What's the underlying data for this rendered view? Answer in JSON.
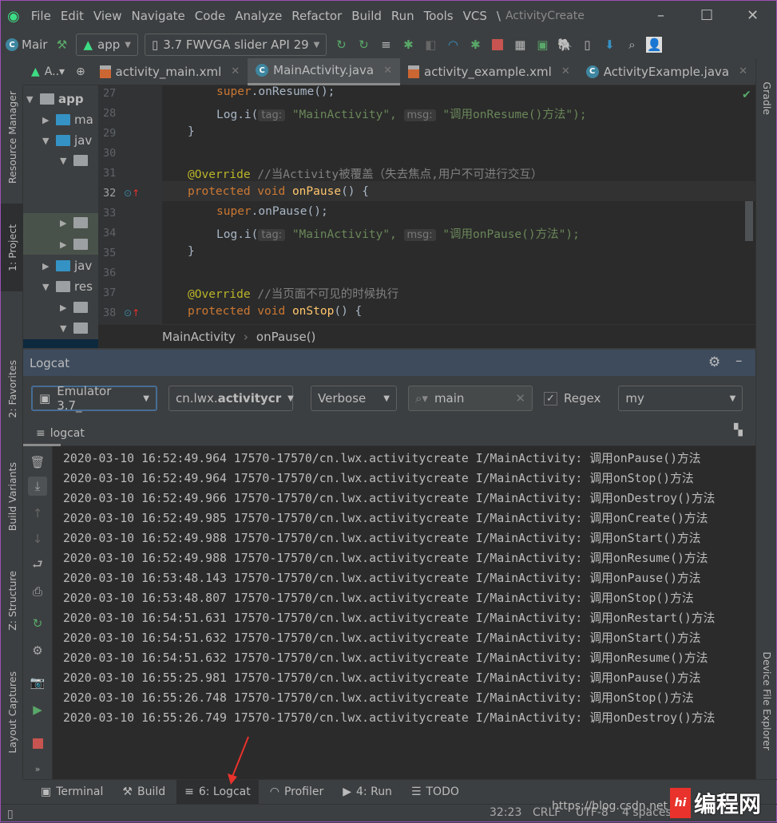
{
  "menu": {
    "items": [
      "File",
      "Edit",
      "View",
      "Navigate",
      "Code",
      "Analyze",
      "Refactor",
      "Build",
      "Run",
      "Tools",
      "VCS",
      "\\"
    ],
    "window_title": "ActivityCreate"
  },
  "toolbar": {
    "breadcrumb": "Mair",
    "run_config": "app",
    "device": "3.7  FWVGA slider API 29"
  },
  "left_strip": {
    "resource_manager": "Resource Manager",
    "project": "1: Project",
    "favorites": "2: Favorites",
    "build_variants": "Build Variants",
    "structure": "Z: Structure",
    "layout_captures": "Layout Captures"
  },
  "right_strip": {
    "gradle": "Gradle",
    "device_file_explorer": "Device File Explorer"
  },
  "project_panel": {
    "header": "A..▾",
    "tree": [
      "app",
      "ma",
      "jav",
      "",
      "",
      "",
      "jav",
      "res",
      "",
      ""
    ]
  },
  "editor_tabs": [
    {
      "label": "activity_main.xml",
      "type": "xml"
    },
    {
      "label": "MainActivity.java",
      "type": "class",
      "active": true
    },
    {
      "label": "activity_example.xml",
      "type": "xml"
    },
    {
      "label": "ActivityExample.java",
      "type": "class"
    }
  ],
  "code": {
    "line_numbers": [
      "27",
      "28",
      "29",
      "30",
      "31",
      "32",
      "33",
      "34",
      "35",
      "36",
      "37",
      "38"
    ],
    "l27": "super.onResume();",
    "l28_pre": "Log.i(",
    "tag_hint": "tag:",
    "l28_tag": "\"MainActivity\",",
    "msg_hint": "msg:",
    "l28_msg": "\"调用onResume()方法\");",
    "close": "}",
    "override": "@Override",
    "c31": "//当Activity被覆盖（失去焦点,用户不可进行交互）",
    "l32_kw": "protected void",
    "l32_fn": "onPause",
    "l32_rest": "() {",
    "l33": "super.onPause();",
    "l34_msg": "\"调用onPause()方法\");",
    "c37": "//当页面不可见的时候执行",
    "l38_fn": "onStop"
  },
  "breadcrumb": {
    "class": "MainActivity",
    "method": "onPause()"
  },
  "logcat": {
    "title": "Logcat",
    "device": "Emulator 3.7_",
    "package_prefix": "cn.lwx.",
    "package_bold": "activitycr",
    "level": "Verbose",
    "search_value": "main",
    "regex_label": "Regex",
    "regex_checked": true,
    "filter": "my",
    "tab": "logcat",
    "lines": [
      "2020-03-10 16:52:49.964 17570-17570/cn.lwx.activitycreate I/MainActivity: 调用onPause()方法",
      "2020-03-10 16:52:49.964 17570-17570/cn.lwx.activitycreate I/MainActivity: 调用onStop()方法",
      "2020-03-10 16:52:49.966 17570-17570/cn.lwx.activitycreate I/MainActivity: 调用onDestroy()方法",
      "2020-03-10 16:52:49.985 17570-17570/cn.lwx.activitycreate I/MainActivity: 调用onCreate()方法",
      "2020-03-10 16:52:49.988 17570-17570/cn.lwx.activitycreate I/MainActivity: 调用onStart()方法",
      "2020-03-10 16:52:49.988 17570-17570/cn.lwx.activitycreate I/MainActivity: 调用onResume()方法",
      "2020-03-10 16:53:48.143 17570-17570/cn.lwx.activitycreate I/MainActivity: 调用onPause()方法",
      "2020-03-10 16:53:48.807 17570-17570/cn.lwx.activitycreate I/MainActivity: 调用onStop()方法",
      "2020-03-10 16:54:51.631 17570-17570/cn.lwx.activitycreate I/MainActivity: 调用onRestart()方法",
      "2020-03-10 16:54:51.632 17570-17570/cn.lwx.activitycreate I/MainActivity: 调用onStart()方法",
      "2020-03-10 16:54:51.632 17570-17570/cn.lwx.activitycreate I/MainActivity: 调用onResume()方法",
      "2020-03-10 16:55:25.981 17570-17570/cn.lwx.activitycreate I/MainActivity: 调用onPause()方法",
      "2020-03-10 16:55:26.748 17570-17570/cn.lwx.activitycreate I/MainActivity: 调用onStop()方法",
      "2020-03-10 16:55:26.749 17570-17570/cn.lwx.activitycreate I/MainActivity: 调用onDestroy()方法"
    ]
  },
  "bottom_tabs": [
    {
      "label": "Terminal"
    },
    {
      "label": "Build"
    },
    {
      "label": "6: Logcat",
      "active": true
    },
    {
      "label": "Profiler"
    },
    {
      "label": "4: Run"
    },
    {
      "label": "TODO"
    }
  ],
  "status": {
    "position": "32:23",
    "line_sep": "CRLF",
    "encoding": "UTF-8",
    "indent": "4 spaces",
    "watermark_url": "https://blog.csdn.net",
    "watermark_logo": "编程网"
  },
  "colors": {
    "accent_arrow": "#e8322b",
    "keyword": "#cc7832",
    "string": "#6a8759",
    "annotation": "#bbb529",
    "function": "#ffc66d"
  }
}
